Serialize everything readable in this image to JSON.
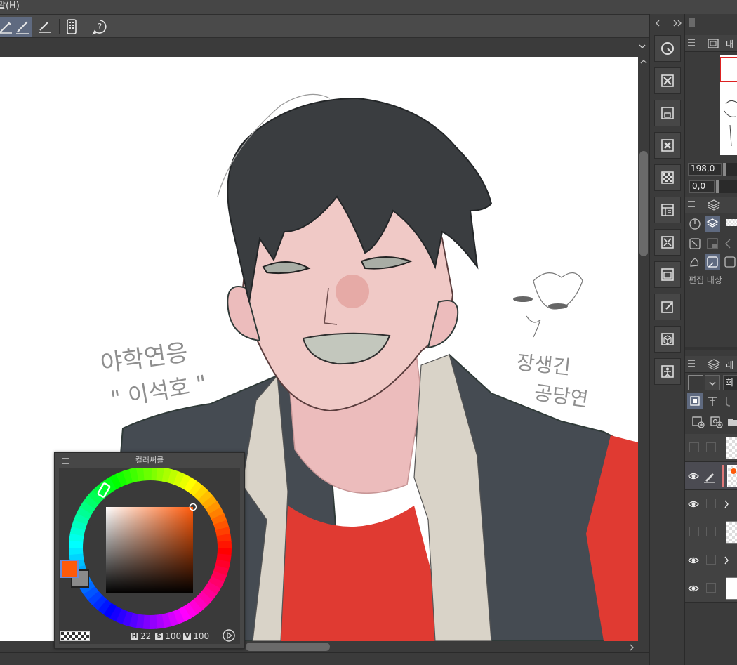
{
  "menu": {
    "partial_label": "말(H)"
  },
  "canvas": {
    "handwriting_left_1": "야학연응",
    "handwriting_left_2": "\" 이석호 \"",
    "handwriting_right_1": "장생긴",
    "handwriting_right_2": "공당연"
  },
  "navigator": {
    "tab_label": "내",
    "zoom_value": "198,0",
    "rotate_value": "0,0"
  },
  "tool_property": {
    "edit_target_label": "편집 대상"
  },
  "layer_panel": {
    "tab_label": "레",
    "blend_mode": "회"
  },
  "color_circle": {
    "title": "컬러써클",
    "h_label": "H",
    "h_value": "22",
    "s_label": "S",
    "s_value": "100",
    "v_label": "V",
    "v_value": "100",
    "main_color": "#ff5a0a",
    "sub_color": "#8a8a8a"
  },
  "colors": {
    "ui_bg": "#3b3b3b",
    "accent": "#5f6a80",
    "jacket": "#454b52",
    "shirt": "#d9d3c8",
    "tee": "#e03a32",
    "skin": "#f0c9c6",
    "hair": "#3a3d40"
  },
  "icons": {
    "toolbar": [
      "pen-tool-icon",
      "brush-tool-icon",
      "ruler-icon",
      "smartphone-icon",
      "help-icon"
    ],
    "command": [
      "selection-circle-icon",
      "clear-icon",
      "save-icon",
      "close-x-icon",
      "checker-icon",
      "layer-property-icon",
      "transform-icon",
      "window-icon",
      "edit-icon",
      "package-icon",
      "person-icon"
    ]
  }
}
